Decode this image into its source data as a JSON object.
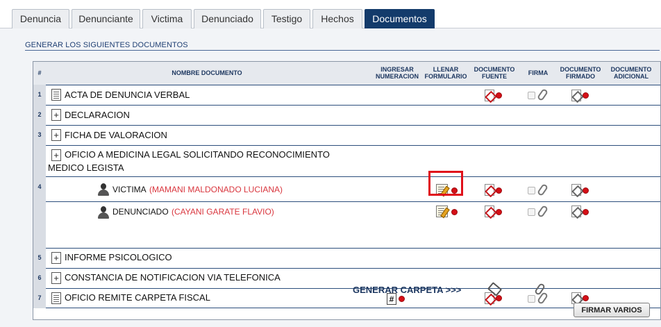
{
  "tabs": [
    {
      "label": "Denuncia",
      "active": false
    },
    {
      "label": "Denunciante",
      "active": false
    },
    {
      "label": "Victima",
      "active": false
    },
    {
      "label": "Denunciado",
      "active": false
    },
    {
      "label": "Testigo",
      "active": false
    },
    {
      "label": "Hechos",
      "active": false
    },
    {
      "label": "Documentos",
      "active": true
    }
  ],
  "section": {
    "title": "GENERAR LOS SIGUIENTES DOCUMENTOS"
  },
  "table": {
    "headers": {
      "num": "#",
      "nombre": "NOMBRE DOCUMENTO",
      "numeracion": "INGRESAR NUMERACION",
      "formulario": "LLENAR FORMULARIO",
      "fuente": "DOCUMENTO FUENTE",
      "firma": "FIRMA",
      "firmado": "DOCUMENTO FIRMADO",
      "adicional": "DOCUMENTO ADICIONAL"
    },
    "rows": [
      {
        "num": "1",
        "label": "ACTA DE DENUNCIA VERBAL",
        "icon": "document-icon"
      },
      {
        "num": "2",
        "label": "DECLARACION",
        "icon": "expand-plus-icon"
      },
      {
        "num": "3",
        "label": "FICHA DE VALORACION",
        "icon": "expand-plus-icon"
      },
      {
        "num": "4",
        "label": "OFICIO A MEDICINA LEGAL SOLICITANDO RECONOCIMIENTO",
        "label2": "MEDICO LEGISTA",
        "icon": "expand-plus-icon",
        "subs": [
          {
            "role": "VICTIMA",
            "name": "(MAMANI MALDONADO LUCIANA)"
          },
          {
            "role": "DENUNCIADO",
            "name": "(CAYANI GARATE FLAVIO)"
          }
        ]
      },
      {
        "num": "5",
        "label": "INFORME PSICOLOGICO",
        "icon": "expand-plus-icon"
      },
      {
        "num": "6",
        "label": "CONSTANCIA DE NOTIFICACION VIA TELEFONICA",
        "icon": "expand-plus-icon"
      },
      {
        "num": "7",
        "label": "OFICIO REMITE CARPETA FISCAL",
        "icon": "document-icon"
      }
    ]
  },
  "footer": {
    "generar": "GENERAR CARPETA >>>",
    "firmar_varios": "FIRMAR VARIOS"
  },
  "colors": {
    "accent": "#133b6b",
    "status_dot": "#d50f17",
    "highlight": "#e0101a",
    "person_name": "#d9363e"
  }
}
